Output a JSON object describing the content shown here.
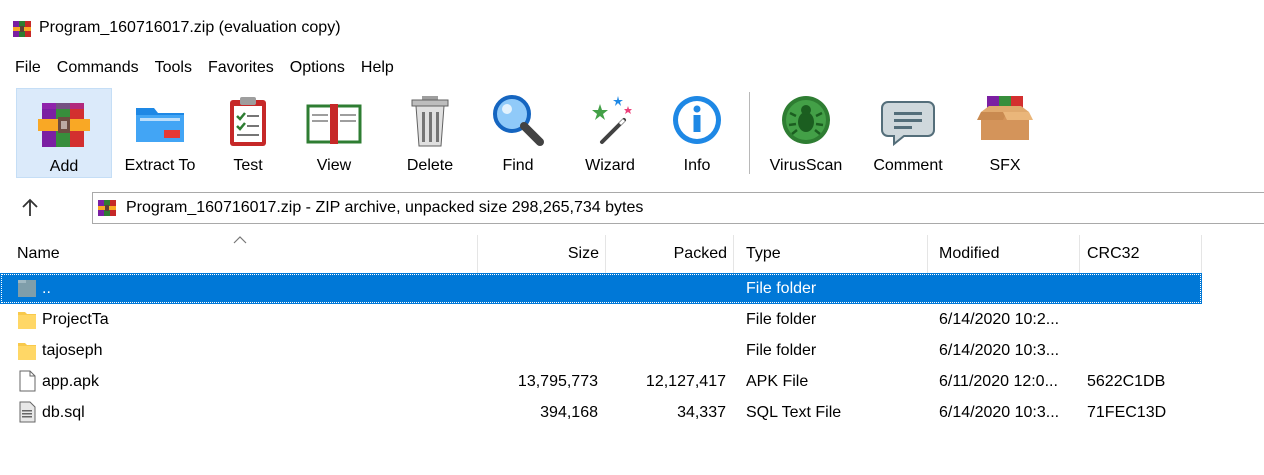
{
  "window": {
    "title": "Program_160716017.zip (evaluation copy)"
  },
  "menu": [
    {
      "id": "file",
      "label": "File"
    },
    {
      "id": "commands",
      "label": "Commands"
    },
    {
      "id": "tools",
      "label": "Tools"
    },
    {
      "id": "favorites",
      "label": "Favorites"
    },
    {
      "id": "options",
      "label": "Options"
    },
    {
      "id": "help",
      "label": "Help"
    }
  ],
  "toolbar": {
    "add": "Add",
    "extract_to": "Extract To",
    "test": "Test",
    "view": "View",
    "delete": "Delete",
    "find": "Find",
    "wizard": "Wizard",
    "info": "Info",
    "virusscan": "VirusScan",
    "comment": "Comment",
    "sfx": "SFX"
  },
  "address": {
    "text": "Program_160716017.zip - ZIP archive, unpacked size 298,265,734 bytes",
    "icon": "winrar-archive-icon"
  },
  "columns": {
    "name": "Name",
    "size": "Size",
    "packed": "Packed",
    "type": "Type",
    "modified": "Modified",
    "crc32": "CRC32"
  },
  "files": [
    {
      "name": "..",
      "size": "",
      "packed": "",
      "type": "File folder",
      "modified": "",
      "crc32": "",
      "icon": "parent-folder-icon",
      "selected": true
    },
    {
      "name": "ProjectTa",
      "size": "",
      "packed": "",
      "type": "File folder",
      "modified": "6/14/2020 10:2...",
      "crc32": "",
      "icon": "folder-icon",
      "selected": false
    },
    {
      "name": "tajoseph",
      "size": "",
      "packed": "",
      "type": "File folder",
      "modified": "6/14/2020 10:3...",
      "crc32": "",
      "icon": "folder-icon",
      "selected": false
    },
    {
      "name": "app.apk",
      "size": "13,795,773",
      "packed": "12,127,417",
      "type": "APK File",
      "modified": "6/11/2020 12:0...",
      "crc32": "5622C1DB",
      "icon": "file-icon",
      "selected": false
    },
    {
      "name": "db.sql",
      "size": "394,168",
      "packed": "34,337",
      "type": "SQL Text File",
      "modified": "6/14/2020 10:3...",
      "crc32": "71FEC13D",
      "icon": "sql-file-icon",
      "selected": false
    }
  ],
  "colors": {
    "selection": "#0078d7",
    "toolbar_active": "#dbeafa"
  }
}
